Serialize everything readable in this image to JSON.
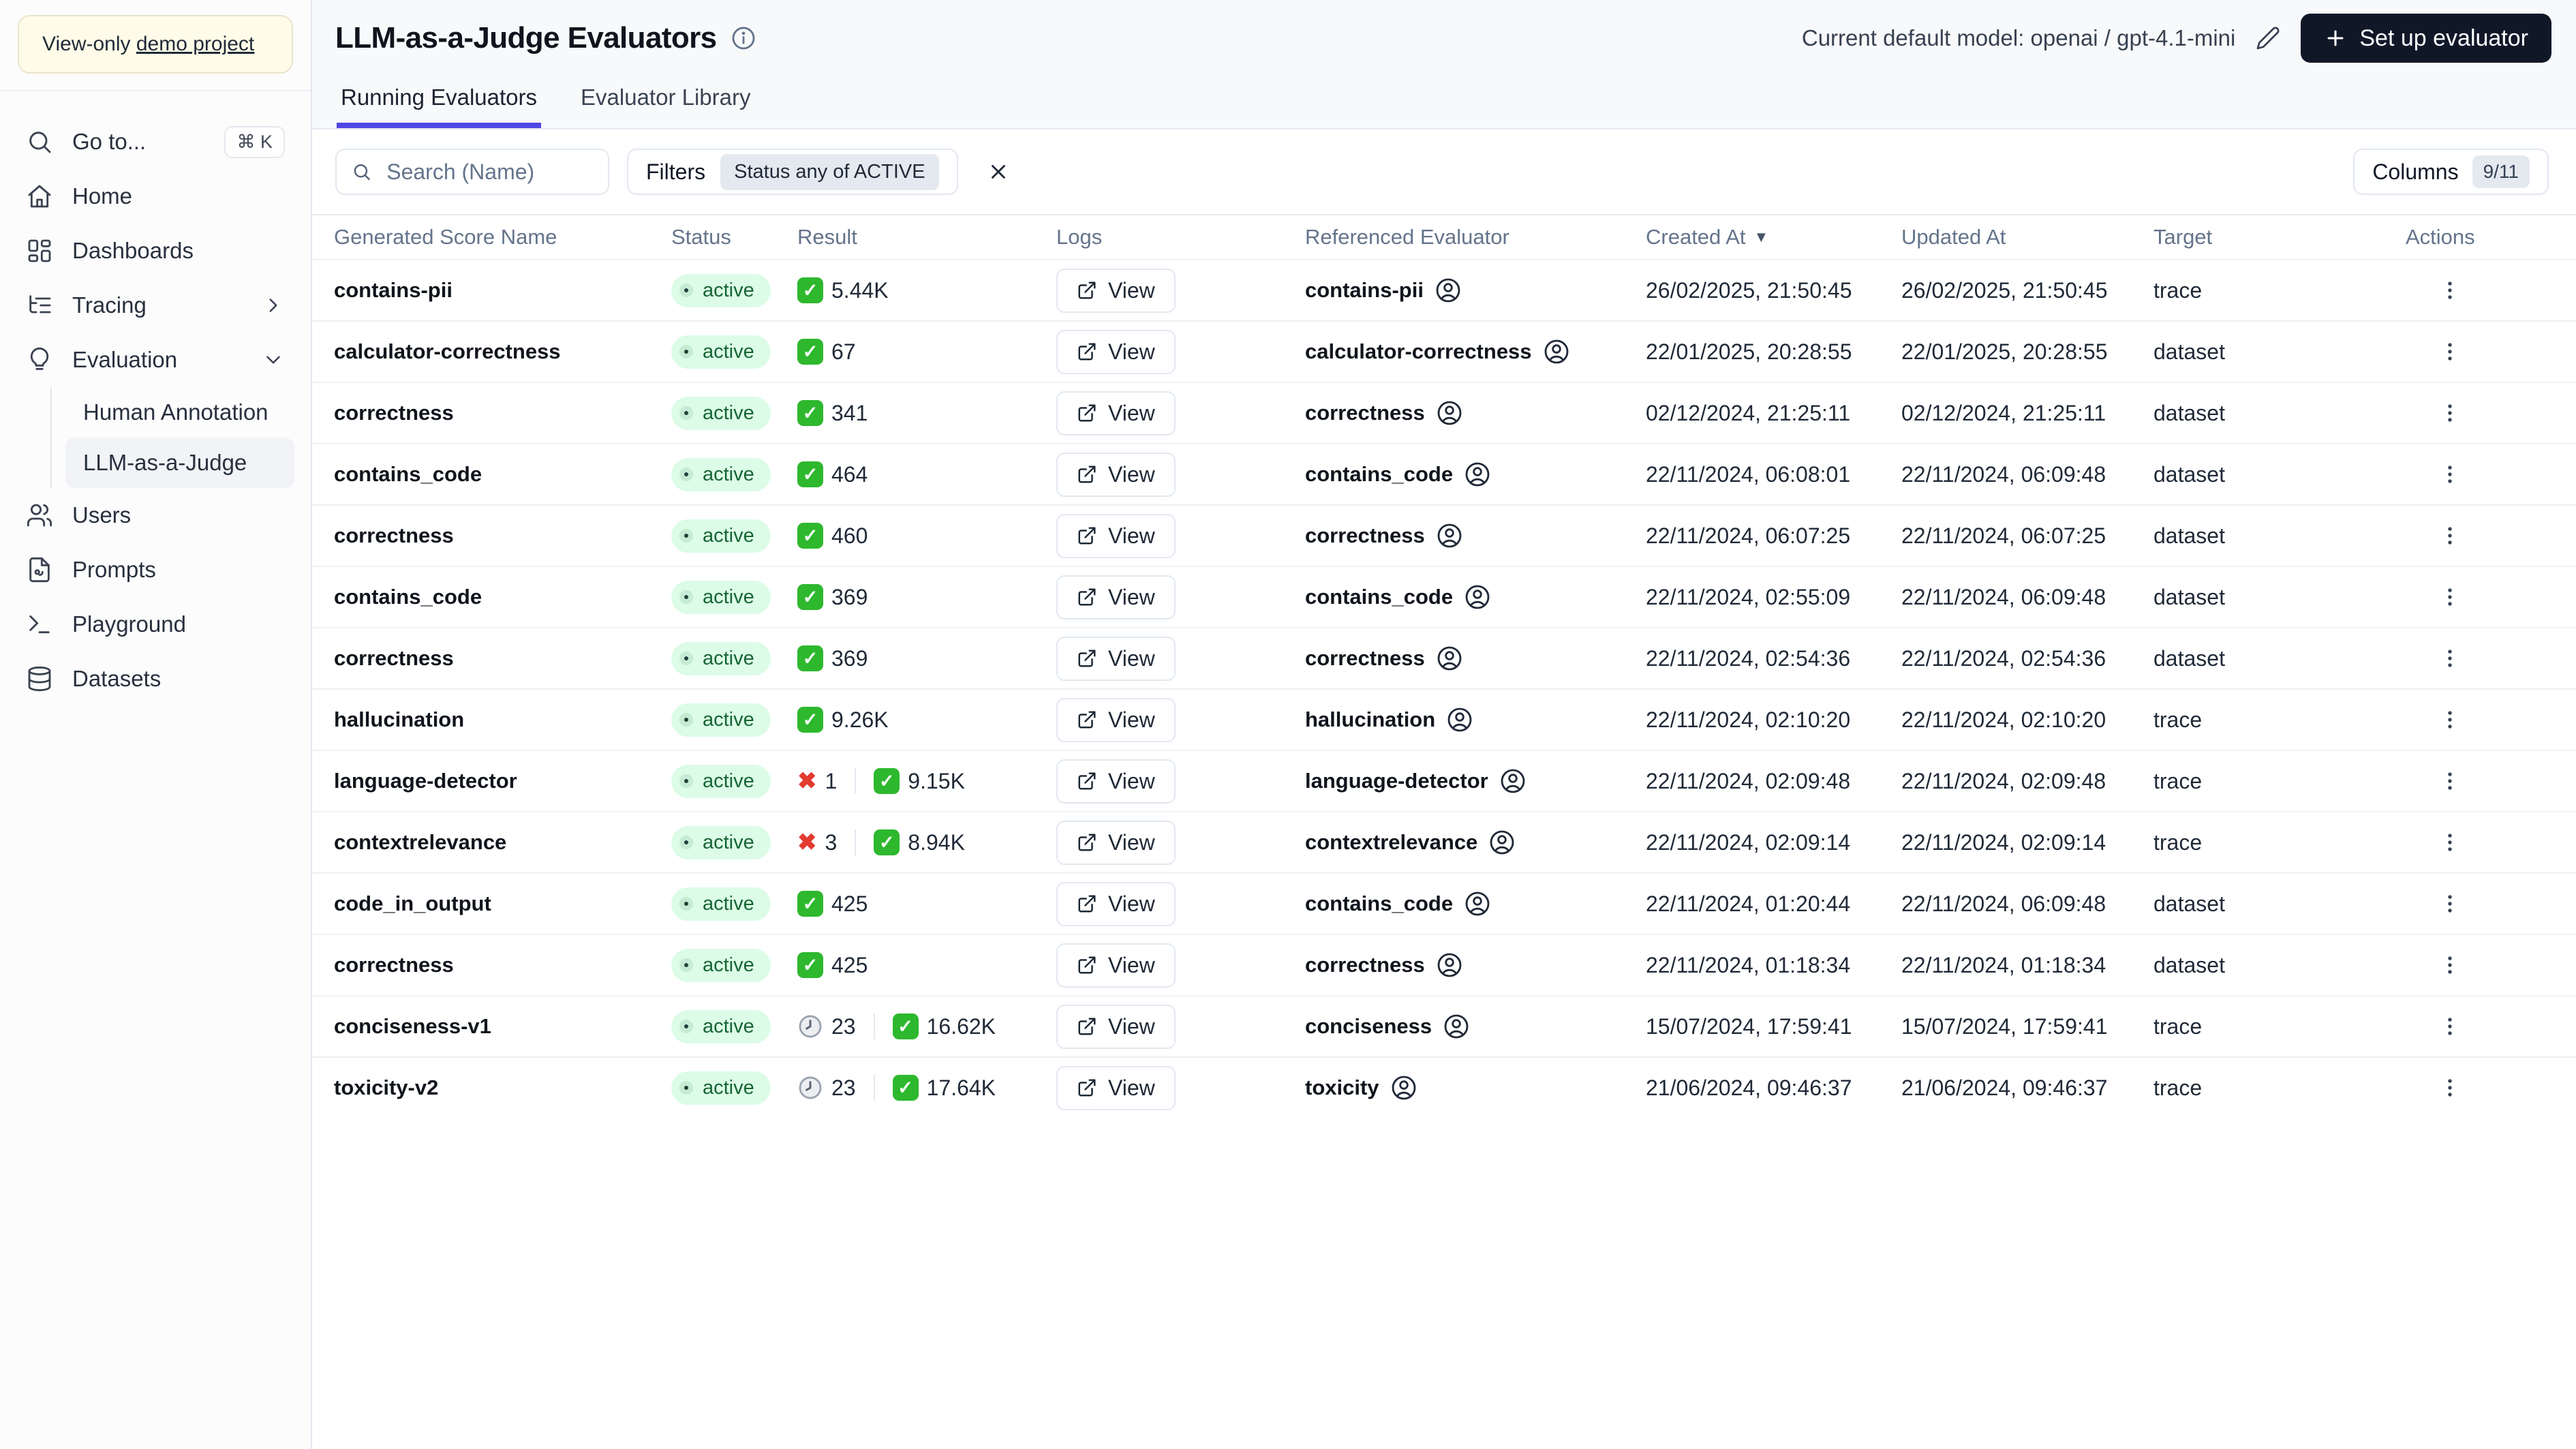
{
  "colors": {
    "accent_indigo": "#4f46e5",
    "primary_button_bg": "#101828",
    "badge_active_bg": "#dcfce7",
    "badge_active_text": "#166534",
    "check_green": "#2eb82e",
    "cross_red": "#e33b30",
    "banner_bg": "#fefce8"
  },
  "sidebar": {
    "banner": {
      "prefix": "View-only ",
      "link": "demo project"
    },
    "goto": {
      "label": "Go to...",
      "shortcut": "⌘ K"
    },
    "items": [
      {
        "label": "Home"
      },
      {
        "label": "Dashboards"
      },
      {
        "label": "Tracing"
      },
      {
        "label": "Evaluation"
      },
      {
        "label": "Users"
      },
      {
        "label": "Prompts"
      },
      {
        "label": "Playground"
      },
      {
        "label": "Datasets"
      }
    ],
    "evaluation_children": [
      {
        "label": "Human Annotation",
        "active": false
      },
      {
        "label": "LLM-as-a-Judge",
        "active": true
      }
    ]
  },
  "header": {
    "title": "LLM-as-a-Judge Evaluators",
    "model_label": "Current default model: openai / gpt-4.1-mini",
    "setup_button": "Set up evaluator"
  },
  "tabs": [
    {
      "label": "Running Evaluators",
      "active": true
    },
    {
      "label": "Evaluator Library",
      "active": false
    }
  ],
  "filters": {
    "search_placeholder": "Search (Name)",
    "filters_label": "Filters",
    "filter_chip": "Status any of ACTIVE",
    "columns_label": "Columns",
    "columns_count": "9/11"
  },
  "table": {
    "columns": [
      "Generated Score Name",
      "Status",
      "Result",
      "Logs",
      "Referenced Evaluator",
      "Created At",
      "Updated At",
      "Target",
      "Actions"
    ],
    "sort_desc_glyph": "▼",
    "logs_label": "View",
    "rows": [
      {
        "name": "contains-pii",
        "status": "active",
        "result": [
          {
            "icon": "check",
            "value": "5.44K"
          }
        ],
        "evaluator": "contains-pii",
        "created": "26/02/2025, 21:50:45",
        "updated": "26/02/2025, 21:50:45",
        "target": "trace"
      },
      {
        "name": "calculator-correctness",
        "status": "active",
        "result": [
          {
            "icon": "check",
            "value": "67"
          }
        ],
        "evaluator": "calculator-correctness",
        "created": "22/01/2025, 20:28:55",
        "updated": "22/01/2025, 20:28:55",
        "target": "dataset"
      },
      {
        "name": "correctness",
        "status": "active",
        "result": [
          {
            "icon": "check",
            "value": "341"
          }
        ],
        "evaluator": "correctness",
        "created": "02/12/2024, 21:25:11",
        "updated": "02/12/2024, 21:25:11",
        "target": "dataset"
      },
      {
        "name": "contains_code",
        "status": "active",
        "result": [
          {
            "icon": "check",
            "value": "464"
          }
        ],
        "evaluator": "contains_code",
        "created": "22/11/2024, 06:08:01",
        "updated": "22/11/2024, 06:09:48",
        "target": "dataset"
      },
      {
        "name": "correctness",
        "status": "active",
        "result": [
          {
            "icon": "check",
            "value": "460"
          }
        ],
        "evaluator": "correctness",
        "created": "22/11/2024, 06:07:25",
        "updated": "22/11/2024, 06:07:25",
        "target": "dataset"
      },
      {
        "name": "contains_code",
        "status": "active",
        "result": [
          {
            "icon": "check",
            "value": "369"
          }
        ],
        "evaluator": "contains_code",
        "created": "22/11/2024, 02:55:09",
        "updated": "22/11/2024, 06:09:48",
        "target": "dataset"
      },
      {
        "name": "correctness",
        "status": "active",
        "result": [
          {
            "icon": "check",
            "value": "369"
          }
        ],
        "evaluator": "correctness",
        "created": "22/11/2024, 02:54:36",
        "updated": "22/11/2024, 02:54:36",
        "target": "dataset"
      },
      {
        "name": "hallucination",
        "status": "active",
        "result": [
          {
            "icon": "check",
            "value": "9.26K"
          }
        ],
        "evaluator": "hallucination",
        "created": "22/11/2024, 02:10:20",
        "updated": "22/11/2024, 02:10:20",
        "target": "trace"
      },
      {
        "name": "language-detector",
        "status": "active",
        "result": [
          {
            "icon": "cross",
            "value": "1"
          },
          {
            "icon": "check",
            "value": "9.15K"
          }
        ],
        "evaluator": "language-detector",
        "created": "22/11/2024, 02:09:48",
        "updated": "22/11/2024, 02:09:48",
        "target": "trace"
      },
      {
        "name": "contextrelevance",
        "status": "active",
        "result": [
          {
            "icon": "cross",
            "value": "3"
          },
          {
            "icon": "check",
            "value": "8.94K"
          }
        ],
        "evaluator": "contextrelevance",
        "created": "22/11/2024, 02:09:14",
        "updated": "22/11/2024, 02:09:14",
        "target": "trace"
      },
      {
        "name": "code_in_output",
        "status": "active",
        "result": [
          {
            "icon": "check",
            "value": "425"
          }
        ],
        "evaluator": "contains_code",
        "created": "22/11/2024, 01:20:44",
        "updated": "22/11/2024, 06:09:48",
        "target": "dataset"
      },
      {
        "name": "correctness",
        "status": "active",
        "result": [
          {
            "icon": "check",
            "value": "425"
          }
        ],
        "evaluator": "correctness",
        "created": "22/11/2024, 01:18:34",
        "updated": "22/11/2024, 01:18:34",
        "target": "dataset"
      },
      {
        "name": "conciseness-v1",
        "status": "active",
        "result": [
          {
            "icon": "clock",
            "value": "23"
          },
          {
            "icon": "check",
            "value": "16.62K"
          }
        ],
        "evaluator": "conciseness",
        "created": "15/07/2024, 17:59:41",
        "updated": "15/07/2024, 17:59:41",
        "target": "trace"
      },
      {
        "name": "toxicity-v2",
        "status": "active",
        "result": [
          {
            "icon": "clock",
            "value": "23"
          },
          {
            "icon": "check",
            "value": "17.64K"
          }
        ],
        "evaluator": "toxicity",
        "created": "21/06/2024, 09:46:37",
        "updated": "21/06/2024, 09:46:37",
        "target": "trace"
      }
    ]
  }
}
